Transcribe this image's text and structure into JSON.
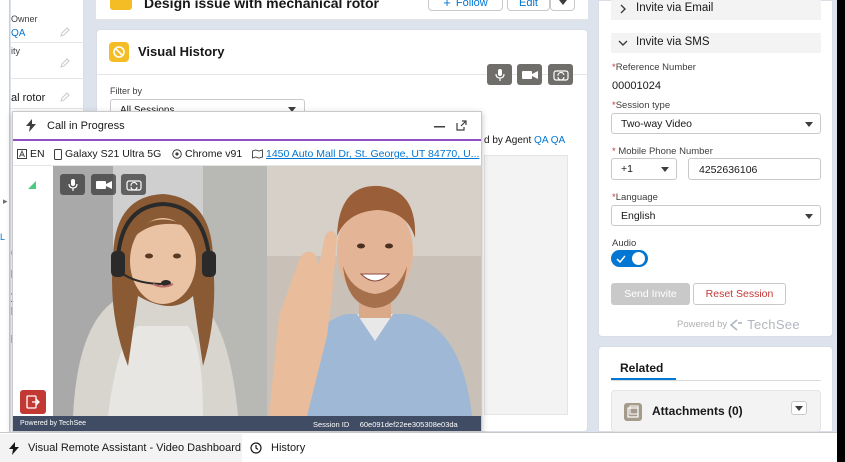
{
  "record": {
    "title": "Design issue with mechanical rotor",
    "follow_label": "Follow",
    "edit_label": "Edit",
    "left_details": {
      "owner_label": "Owner",
      "owner_value": "QA",
      "field2_label": "ity",
      "field3_value": "al rotor"
    }
  },
  "visual_history": {
    "title": "Visual History",
    "filter_label": "Filter by",
    "filter_value": "All Sessions",
    "agent_text": "d by Agent",
    "agent_link": "QA QA"
  },
  "call": {
    "title": "Call in Progress",
    "language": "EN",
    "device": "Galaxy S21 Ultra 5G",
    "browser": "Chrome v91",
    "address": "1450 Auto Mall Dr, St. George, UT 84770, U...",
    "footer_powered": "Powered by TechSee",
    "footer_session_label": "Session ID",
    "footer_session_id": "60e091def22ee305308e03da"
  },
  "invite": {
    "email_label": "Invite via Email",
    "sms_label": "Invite via SMS",
    "reference_label": "Reference Number",
    "reference_value": "00001024",
    "session_type_label": "Session type",
    "session_type_value": "Two-way Video",
    "phone_label": "Mobile Phone Number",
    "country_code": "+1",
    "phone_value": "4252636106",
    "language_label": "Language",
    "language_value": "English",
    "audio_label": "Audio",
    "audio_on": true,
    "send_label": "Send Invite",
    "reset_label": "Reset Session",
    "powered_label": "Powered by",
    "brand_label": "TechSee"
  },
  "related": {
    "tab_label": "Related",
    "attachments_label": "Attachments (0)"
  },
  "utility_bar": {
    "item1": "Visual Remote Assistant - Video Dashboard",
    "item2": "History"
  },
  "colors": {
    "accent": "#0176d3",
    "danger": "#c23934",
    "call_header_border": "#9050c8",
    "footer": "#3f4c63"
  }
}
